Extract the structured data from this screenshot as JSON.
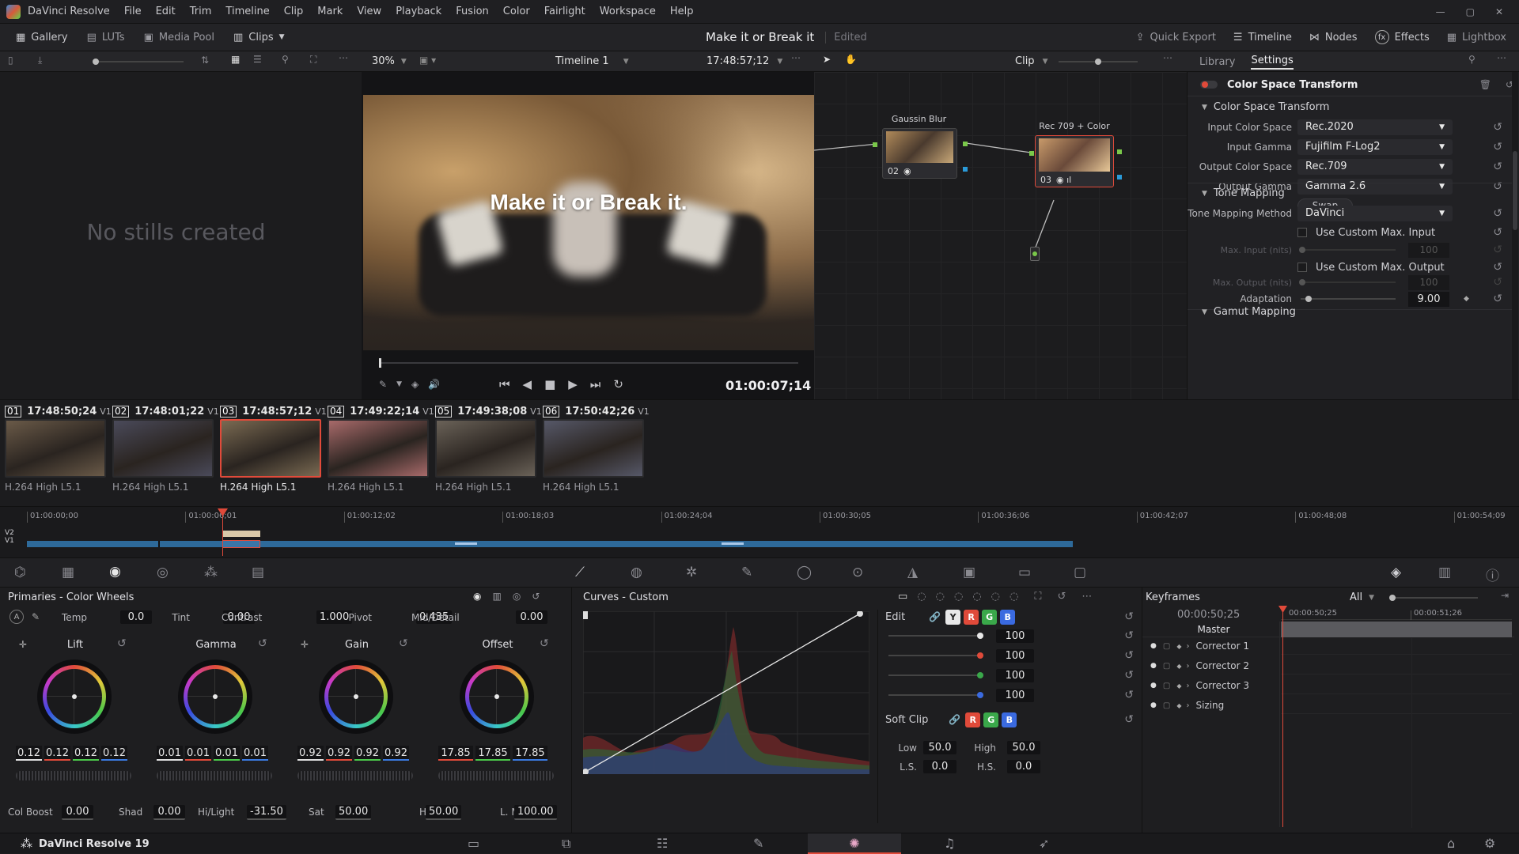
{
  "app": {
    "name": "DaVinci Resolve",
    "menu": [
      "File",
      "Edit",
      "Trim",
      "Timeline",
      "Clip",
      "Mark",
      "View",
      "Playback",
      "Fusion",
      "Color",
      "Fairlight",
      "Workspace",
      "Help"
    ],
    "window_controls": [
      "minimize",
      "restore",
      "close"
    ]
  },
  "toolbar": {
    "left": [
      {
        "label": "Gallery",
        "icon": "gallery-icon"
      },
      {
        "label": "LUTs",
        "icon": "luts-icon"
      },
      {
        "label": "Media Pool",
        "icon": "media-pool-icon"
      },
      {
        "label": "Clips",
        "icon": "clips-icon"
      }
    ],
    "project_title": "Make it or Break it",
    "project_status": "Edited",
    "right": [
      {
        "label": "Quick Export",
        "icon": "export-icon"
      },
      {
        "label": "Timeline",
        "icon": "timeline-icon"
      },
      {
        "label": "Nodes",
        "icon": "nodes-icon"
      },
      {
        "label": "Effects",
        "icon": "fx-icon"
      },
      {
        "label": "Lightbox",
        "icon": "lightbox-icon"
      }
    ]
  },
  "viewer_bar": {
    "zoom": "30%",
    "timeline_name": "Timeline 1",
    "timecode": "17:48:57;12",
    "mode": "Clip"
  },
  "gallery": {
    "empty_text": "No stills created"
  },
  "viewer": {
    "overlay_text": "Make it or Break it.",
    "timecode": "01:00:07;14"
  },
  "nodes": [
    {
      "label": "Gaussin Blur",
      "number": "02"
    },
    {
      "label": "Rec 709 + Color ...",
      "number": "03"
    }
  ],
  "inspector": {
    "tabs": [
      "Library",
      "Settings"
    ],
    "active_tab": "Settings",
    "effect_title": "Color Space Transform",
    "section1": "Color Space Transform",
    "fields": [
      {
        "label": "Input Color Space",
        "value": "Rec.2020"
      },
      {
        "label": "Input Gamma",
        "value": "Fujifilm F-Log2"
      },
      {
        "label": "Output Color Space",
        "value": "Rec.709"
      },
      {
        "label": "Output Gamma",
        "value": "Gamma 2.6"
      }
    ],
    "swap_label": "Swap",
    "section2": "Tone Mapping",
    "tone_method_label": "Tone Mapping Method",
    "tone_method_value": "DaVinci",
    "custom_max_input": "Use Custom Max. Input",
    "max_input_label": "Max. Input (nits)",
    "max_input_value": "100",
    "custom_max_output": "Use Custom Max. Output",
    "max_output_label": "Max. Output (nits)",
    "max_output_value": "100",
    "adaptation_label": "Adaptation",
    "adaptation_value": "9.00",
    "section3": "Gamut Mapping"
  },
  "clips": [
    {
      "num": "01",
      "tc": "17:48:50;24",
      "track": "V1",
      "codec": "H.264 High L5.1",
      "color": "#6a5a48"
    },
    {
      "num": "02",
      "tc": "17:48:01;22",
      "track": "V1",
      "codec": "H.264 High L5.1",
      "color": "#4a4a5a"
    },
    {
      "num": "03",
      "tc": "17:48:57;12",
      "track": "V1",
      "codec": "H.264 High L5.1",
      "color": "#7a6a52"
    },
    {
      "num": "04",
      "tc": "17:49:22;14",
      "track": "V1",
      "codec": "H.264 High L5.1",
      "color": "#a86a6a"
    },
    {
      "num": "05",
      "tc": "17:49:38;08",
      "track": "V1",
      "codec": "H.264 High L5.1",
      "color": "#6a6258"
    },
    {
      "num": "06",
      "tc": "17:50:42;26",
      "track": "V1",
      "codec": "H.264 High L5.1",
      "color": "#565868"
    }
  ],
  "selected_clip": "03",
  "mini_timeline": {
    "ticks": [
      "01:00:00;00",
      "01:00:06;01",
      "01:00:12;02",
      "01:00:18;03",
      "01:00:24;04",
      "01:00:30;05",
      "01:00:36;06",
      "01:00:42;07",
      "01:00:48;08",
      "01:00:54;09"
    ],
    "tracks": [
      "V2",
      "V1"
    ]
  },
  "primaries": {
    "title": "Primaries - Color Wheels",
    "top_params": [
      {
        "label": "Temp",
        "value": "0.0"
      },
      {
        "label": "Tint",
        "value": "0.00"
      },
      {
        "label": "Contrast",
        "value": "1.000"
      },
      {
        "label": "Pivot",
        "value": "0.435"
      },
      {
        "label": "Mid/Detail",
        "value": "0.00"
      }
    ],
    "wheels": [
      {
        "name": "Lift",
        "values": [
          "0.12",
          "0.12",
          "0.12",
          "0.12"
        ]
      },
      {
        "name": "Gamma",
        "values": [
          "0.01",
          "0.01",
          "0.01",
          "0.01"
        ]
      },
      {
        "name": "Gain",
        "values": [
          "0.92",
          "0.92",
          "0.92",
          "0.92"
        ]
      },
      {
        "name": "Offset",
        "values": [
          "17.85",
          "17.85",
          "17.85"
        ]
      }
    ],
    "bottom_params": [
      {
        "label": "Col Boost",
        "value": "0.00"
      },
      {
        "label": "Shad",
        "value": "0.00"
      },
      {
        "label": "Hi/Light",
        "value": "-31.50"
      },
      {
        "label": "Sat",
        "value": "50.00"
      },
      {
        "label": "Hue",
        "value": "50.00"
      },
      {
        "label": "L. Mix",
        "value": "100.00"
      }
    ]
  },
  "curves": {
    "title": "Curves - Custom",
    "edit_label": "Edit",
    "channels": [
      "Y",
      "R",
      "G",
      "B"
    ],
    "channel_values": [
      "100",
      "100",
      "100",
      "100"
    ],
    "soft_clip_label": "Soft Clip",
    "low_label": "Low",
    "low_value": "50.0",
    "high_label": "High",
    "high_value": "50.0",
    "ls_label": "L.S.",
    "ls_value": "0.0",
    "hs_label": "H.S.",
    "hs_value": "0.0"
  },
  "keyframes": {
    "title": "Keyframes",
    "filter": "All",
    "current_tc": "00:00:50;25",
    "ruler_ticks": [
      "00:00:50;25",
      "00:00:51;26"
    ],
    "master_label": "Master",
    "rows": [
      "Corrector 1",
      "Corrector 2",
      "Corrector 3",
      "Sizing"
    ]
  },
  "footer": {
    "app_label": "DaVinci Resolve 19"
  },
  "colors": {
    "accent_red": "#e04a3a",
    "timeline_blue": "#3a76a8",
    "panel_bg": "#1e1e20"
  }
}
